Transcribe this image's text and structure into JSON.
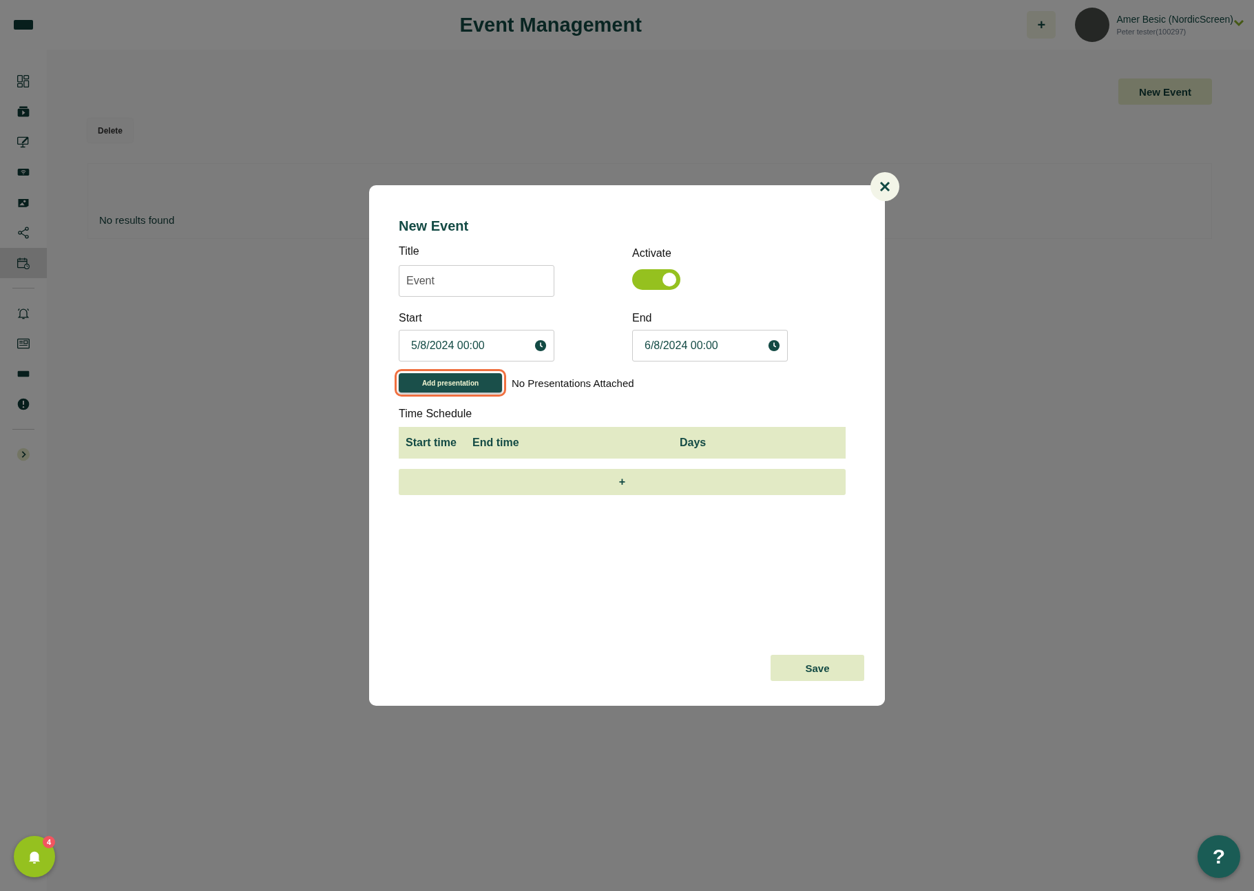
{
  "header": {
    "title": "Event Management",
    "add_button": "+",
    "user": {
      "name": "Amer Besic (NordicScreen)",
      "subtitle": "Peter tester(100297)"
    }
  },
  "sidebar": {
    "groups": [
      {
        "items": [
          {
            "selected": false
          },
          {
            "selected": false
          },
          {
            "selected": false
          },
          {
            "selected": false
          },
          {
            "selected": false
          },
          {
            "selected": false
          },
          {
            "selected": true
          }
        ]
      },
      {
        "items": [
          {
            "selected": false
          },
          {
            "selected": false
          },
          {
            "selected": false
          },
          {
            "selected": false
          }
        ]
      },
      {
        "items": [
          {
            "selected": false
          }
        ]
      }
    ]
  },
  "main": {
    "new_button": "New Event",
    "delete_button": "Delete",
    "empty_text": "No results found"
  },
  "modal": {
    "title": "New Event",
    "title_field": {
      "label": "Title",
      "value": "Event"
    },
    "activate": {
      "label": "Activate",
      "on": true
    },
    "start": {
      "label": "Start",
      "value": "5/8/2024 00:00"
    },
    "end": {
      "label": "End",
      "value": "6/8/2024 00:00"
    },
    "add_presentation": {
      "label": "Add presentation",
      "highlighted": true
    },
    "presentations_text": "No Presentations Attached",
    "schedule": {
      "label": "Time Schedule",
      "columns": [
        "Start time",
        "End time",
        "Days"
      ],
      "add_row": "+"
    },
    "save": "Save"
  },
  "notifications": {
    "count": "4"
  },
  "help": "?"
}
